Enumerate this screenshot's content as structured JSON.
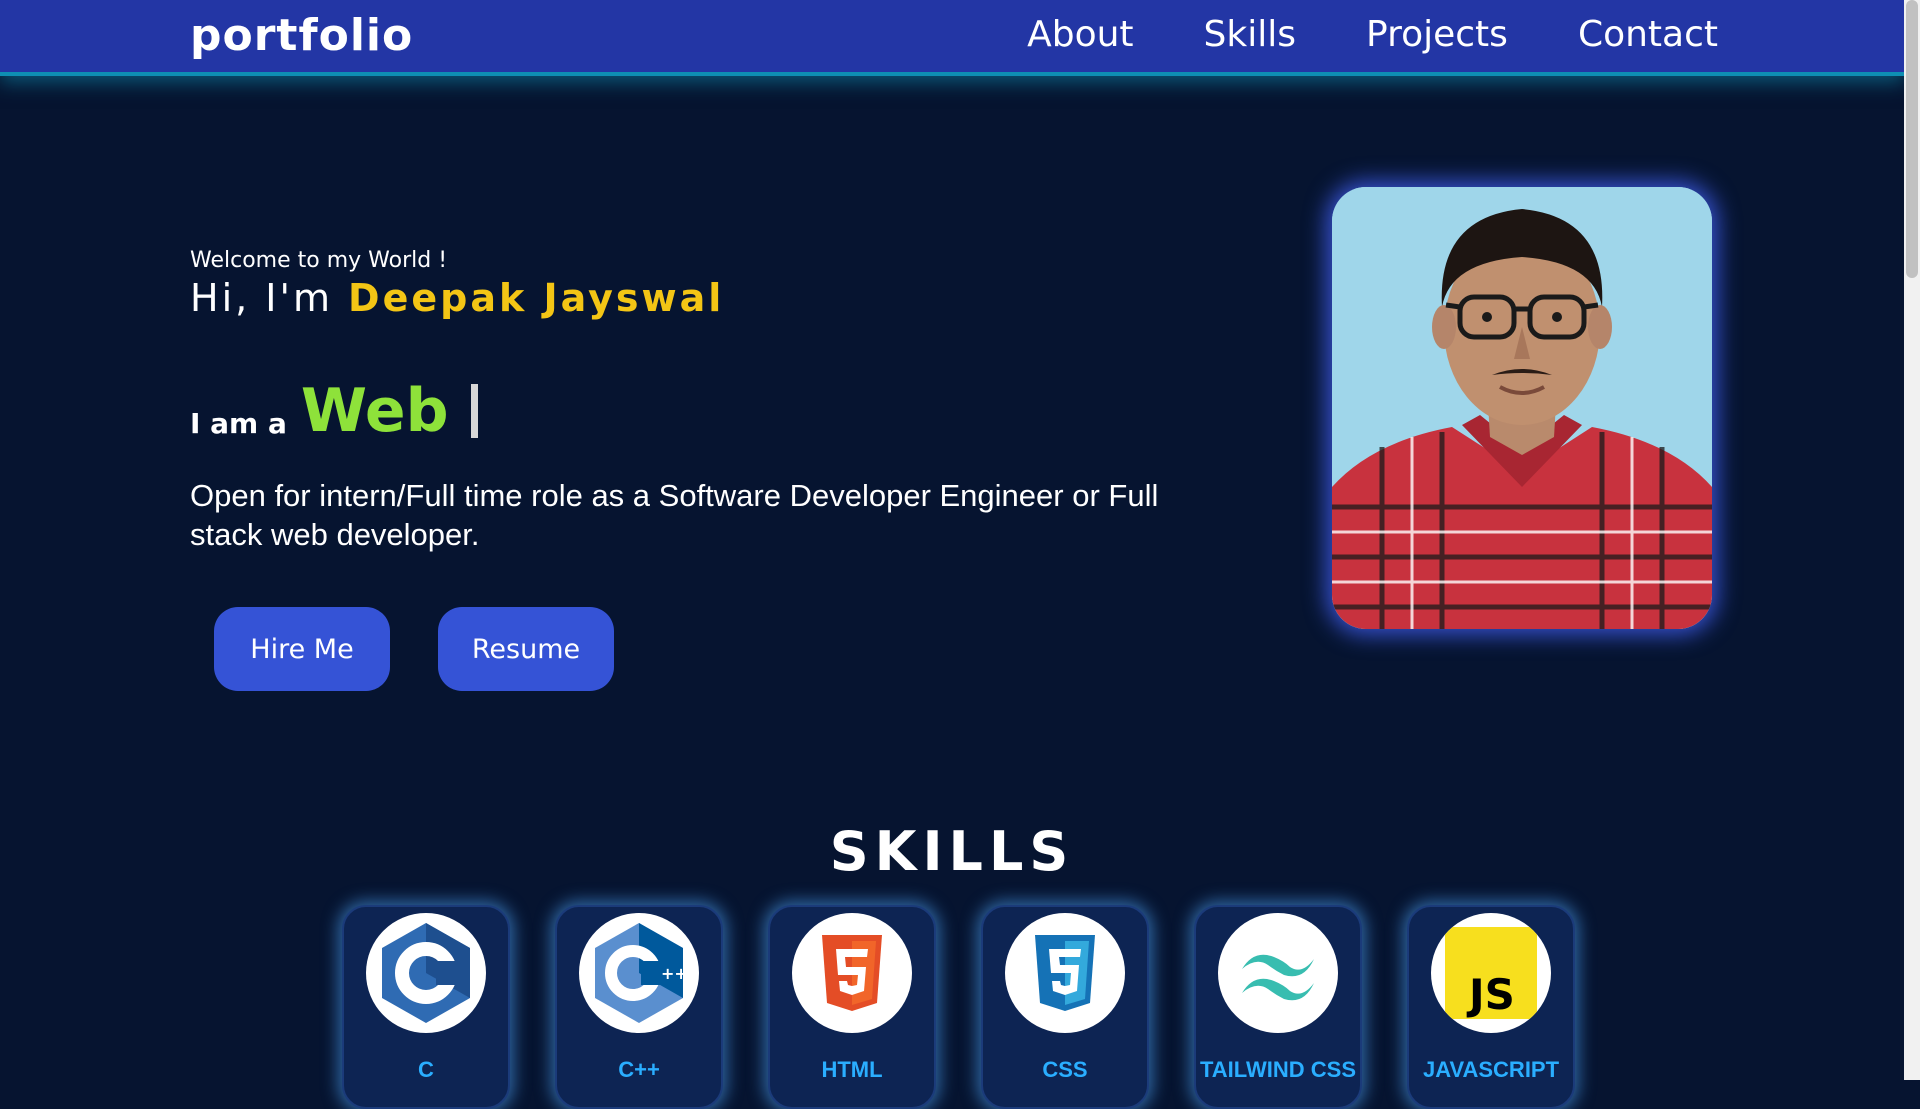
{
  "nav": {
    "brand": "portfolio",
    "links": [
      "About",
      "Skills",
      "Projects",
      "Contact"
    ]
  },
  "hero": {
    "welcome": "Welcome to my World !",
    "greeting_prefix": "Hi, I'm ",
    "name": "Deepak Jayswal",
    "role_prefix": "I am a",
    "role_word": "Web",
    "intro": "Open for intern/Full time role as a Software Developer Engineer or Full stack web developer.",
    "hire_button": "Hire Me",
    "resume_button": "Resume"
  },
  "skills": {
    "title": "SKILLS",
    "items": [
      {
        "label": "C",
        "icon": "c-language-icon"
      },
      {
        "label": "C++",
        "icon": "cpp-language-icon"
      },
      {
        "label": "HTML",
        "icon": "html5-icon"
      },
      {
        "label": "CSS",
        "icon": "css3-icon"
      },
      {
        "label": "TAILWIND CSS",
        "icon": "tailwind-css-icon"
      },
      {
        "label": "JAVASCRIPT",
        "icon": "javascript-icon"
      }
    ]
  },
  "colors": {
    "navbar": "#2336a5",
    "background": "#061430",
    "name_accent": "#f3c515",
    "role_accent": "#8ee23a",
    "button": "#3553d6",
    "skill_label": "#2aaeff"
  }
}
